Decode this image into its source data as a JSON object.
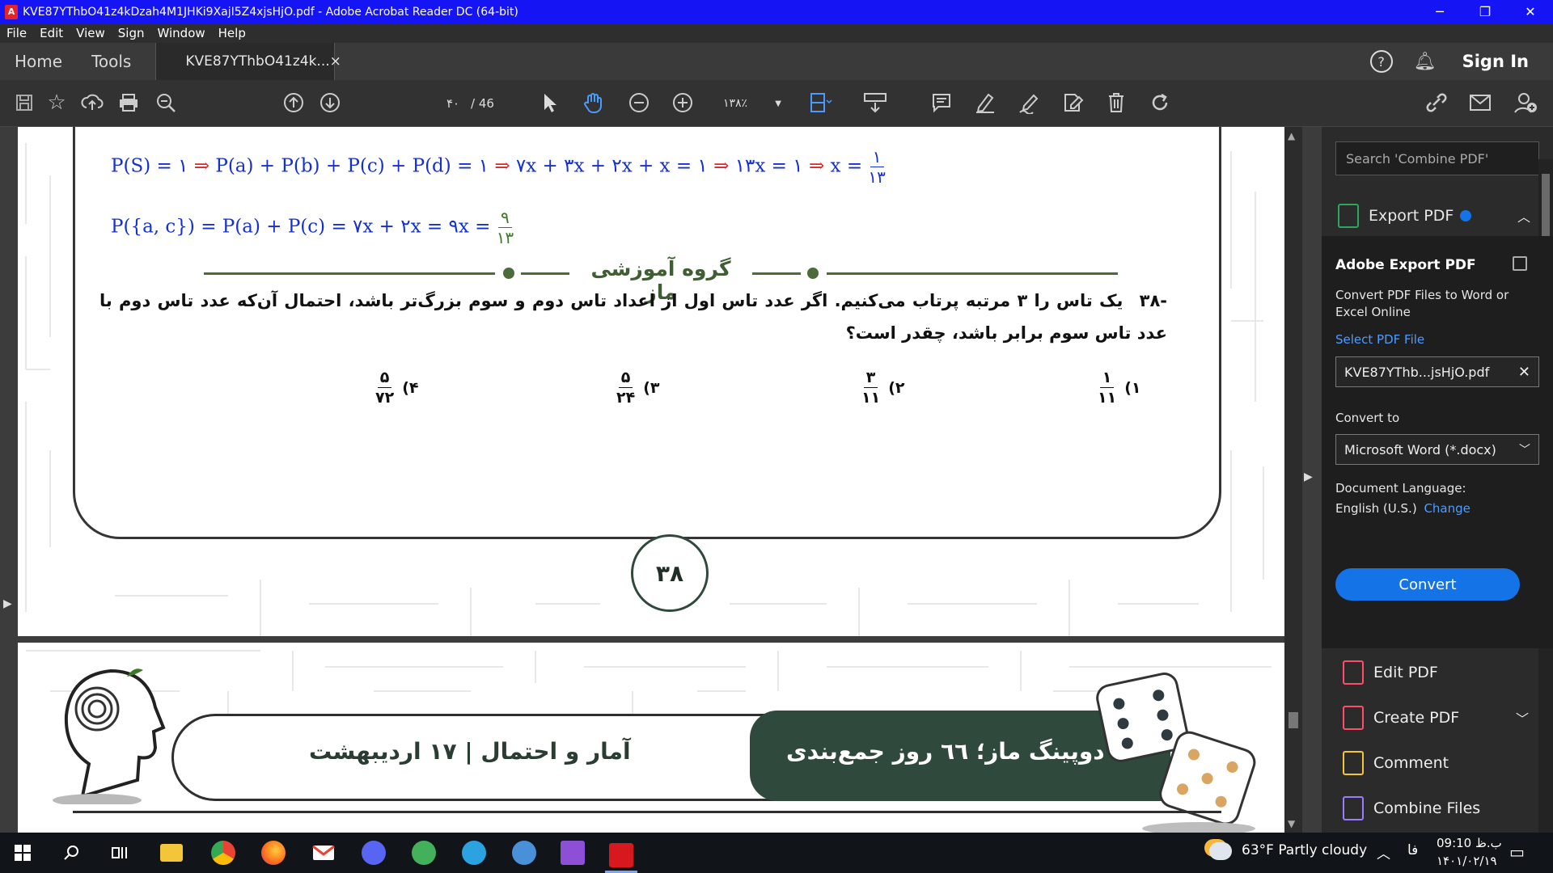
{
  "window": {
    "title": "KVE87YThbO41z4kDzah4M1JHKi9XajI5Z4xjsHjO.pdf - Adobe Acrobat Reader DC (64-bit)",
    "app_icon": "acrobat-icon",
    "buttons": {
      "minimize": "─",
      "restore": "❐",
      "close": "✕"
    }
  },
  "menu": [
    "File",
    "Edit",
    "View",
    "Sign",
    "Window",
    "Help"
  ],
  "tabs": {
    "home": "Home",
    "tools": "Tools",
    "doc_tab": "KVE87YThbO41z4k...",
    "doc_tab_close": "×",
    "signin": "Sign In"
  },
  "toolbar": {
    "page_current": "۴۰",
    "page_total": "/ 46",
    "zoom": "۱۳۸٪"
  },
  "document": {
    "formula1": {
      "lhs": "P(S) = ۱",
      "p2": "P(a) + P(b) + P(c) + P(d) = ۱",
      "p3": "۷x + ۳x + ۲x + x = ۱",
      "p4": "۱۳x = ۱",
      "p5": "x =",
      "frac_num": "۱",
      "frac_den": "۱۳",
      "arrow": "⇒"
    },
    "formula2": {
      "text": "P({a, c}) = P(a) + P(c) = ۷x + ۲x = ۹x =",
      "frac_num": "۹",
      "frac_den": "۱۳"
    },
    "divider_label": "گروه آموزشی ماز",
    "question_number": "-۳۸",
    "question_text": "یک تاس را ۳ مرتبه پرتاب می‌کنیم. اگر عدد تاس اول از اعداد تاس دوم و سوم بزرگ‌تر باشد، احتمال آن‌که عدد تاس دوم با عدد تاس سوم برابر باشد، چقدر است؟",
    "options": [
      {
        "label": "۱)",
        "num": "۱",
        "den": "۱۱"
      },
      {
        "label": "۲)",
        "num": "۳",
        "den": "۱۱"
      },
      {
        "label": "۳)",
        "num": "۵",
        "den": "۲۴"
      },
      {
        "label": "۴)",
        "num": "۵",
        "den": "۷۲"
      }
    ],
    "page_number": "۳۸"
  },
  "page2": {
    "banner_left": "آمار و احتمال | ۱۷ اردیبهشت",
    "banner_right": "دوپینگ ماز؛ ٦٦ روز جمع‌بندی"
  },
  "right_panel": {
    "search_placeholder": "Search 'Combine PDF'",
    "export_title": "Export PDF",
    "heading": "Adobe Export PDF",
    "desc": "Convert PDF Files to Word or Excel Online",
    "select_label": "Select PDF File",
    "file_name": "KVE87YThb...jsHjO.pdf",
    "convert_to_label": "Convert to",
    "convert_to_value": "Microsoft Word (*.docx)",
    "doc_lang_label": "Document Language:",
    "doc_lang_value": "English (U.S.)",
    "change_link": "Change",
    "convert_button": "Convert",
    "tools": [
      "Edit PDF",
      "Create PDF",
      "Comment",
      "Combine Files"
    ]
  },
  "taskbar": {
    "weather": "63°F  Partly cloudy",
    "lang": "فا",
    "time": "09:10 ب.ظ",
    "date": "۱۴۰۱/۰۲/۱۹"
  },
  "colors": {
    "titlebar": "#1414f5",
    "formula_blue": "#1530d0",
    "arrow_red": "#e32222",
    "fraction_green": "#3d7a28",
    "banner_dark": "#2f4a3c",
    "convert_blue": "#1473e6"
  }
}
